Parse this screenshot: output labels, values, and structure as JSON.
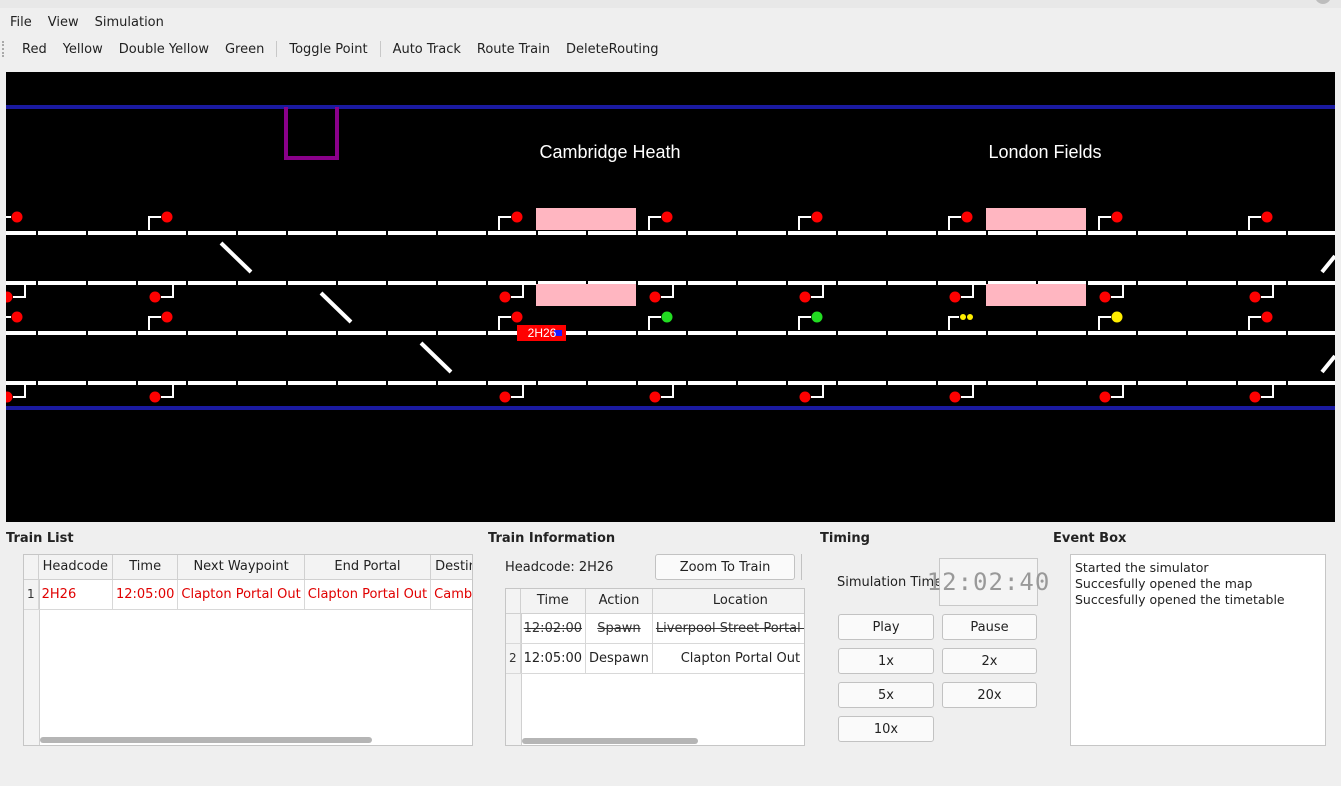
{
  "menu": {
    "file": "File",
    "view": "View",
    "simulation": "Simulation"
  },
  "toolbar": {
    "red": "Red",
    "yellow": "Yellow",
    "double_yellow": "Double Yellow",
    "green": "Green",
    "toggle_point": "Toggle Point",
    "auto_track": "Auto Track",
    "route_train": "Route Train",
    "delete_routing": "DeleteRouting"
  },
  "map": {
    "stations": [
      "Cambridge Heath",
      "London Fields"
    ],
    "train_label": "2H26",
    "colors": {
      "background": "#000000",
      "track": "#ffffff",
      "boundary": "#1a1aa0",
      "platform": "#ffb6c1",
      "signal_red": "#ff0000",
      "signal_green": "#22dd22",
      "signal_yellow": "#ffee00",
      "portal": "#8a008a"
    }
  },
  "train_list": {
    "title": "Train List",
    "columns": [
      "Headcode",
      "Time",
      "Next Waypoint",
      "End Portal",
      "Destination"
    ],
    "rows": [
      {
        "index": "1",
        "headcode": "2H26",
        "time": "12:05:00",
        "next_waypoint": "Clapton Portal Out",
        "end_portal": "Clapton Portal Out",
        "destination": "Cambridge Heath"
      }
    ]
  },
  "train_info": {
    "title": "Train Information",
    "headcode_label": "Headcode: 2H26",
    "zoom_button": "Zoom To Train",
    "columns": [
      "Time",
      "Action",
      "Location"
    ],
    "rows": [
      {
        "index": "",
        "time": "12:02:00",
        "action": "Spawn",
        "location": "Liverpool Street Portal Fast In"
      },
      {
        "index": "2",
        "time": "12:05:00",
        "action": "Despawn",
        "location": "Clapton Portal Out"
      }
    ]
  },
  "timing": {
    "title": "Timing",
    "sim_time_label": "Simulation Time",
    "clock": "12:02:40",
    "buttons": {
      "play": "Play",
      "pause": "Pause",
      "x1": "1x",
      "x2": "2x",
      "x5": "5x",
      "x20": "20x",
      "x10": "10x"
    }
  },
  "event_box": {
    "title": "Event Box",
    "lines": [
      "Started the simulator",
      "Succesfully opened the map",
      "Succesfully opened the timetable"
    ]
  }
}
